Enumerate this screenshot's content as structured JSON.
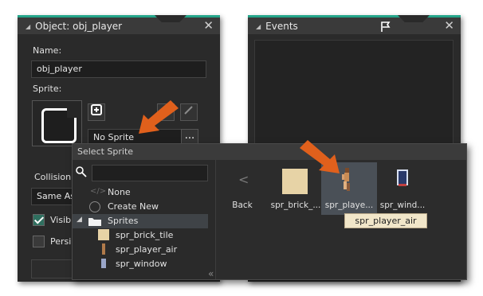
{
  "object_panel": {
    "title": "Object: obj_player",
    "name_label": "Name:",
    "name_value": "obj_player",
    "sprite_label": "Sprite:",
    "sprite_value": "No Sprite",
    "more_label": "...",
    "collision_label": "Collision",
    "collision_value": "Same As",
    "visible_label": "Visible",
    "persistent_label": "Persi"
  },
  "events_panel": {
    "title": "Events"
  },
  "select_sprite": {
    "title": "Select Sprite",
    "search_placeholder": "",
    "tree": {
      "none_label": "None",
      "create_new_label": "Create New",
      "folder_label": "Sprites",
      "items": [
        "spr_brick_tile",
        "spr_player_air",
        "spr_window"
      ]
    },
    "assets": {
      "back_label": "Back",
      "brick_label": "spr_brick_...",
      "player_label": "spr_playe...",
      "window_label": "spr_wind..."
    },
    "tooltip": "spr_player_air",
    "collapse_label": "«"
  },
  "colors": {
    "accent": "#24a58a",
    "arrow": "#e0601c",
    "tile": "#e7d3a6"
  }
}
